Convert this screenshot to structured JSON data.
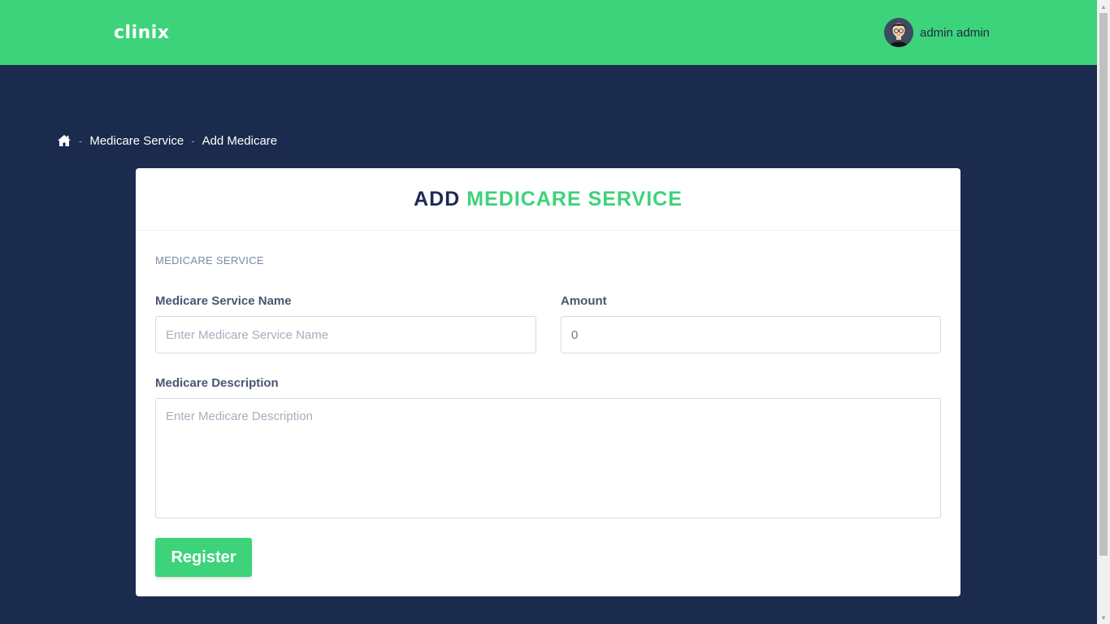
{
  "header": {
    "logo": "clinix",
    "user_name": "admin admin",
    "avatar_icon": "user-avatar-icon"
  },
  "breadcrumb": {
    "home_icon": "home-icon",
    "items": [
      "Medicare Service",
      "Add Medicare"
    ],
    "separator": "-"
  },
  "card": {
    "title_part1": "ADD",
    "title_part2": "MEDICARE SERVICE",
    "section_label": "MEDICARE SERVICE",
    "fields": {
      "service_name": {
        "label": "Medicare Service Name",
        "placeholder": "Enter Medicare Service Name",
        "value": ""
      },
      "amount": {
        "label": "Amount",
        "placeholder": "",
        "value": "0"
      },
      "description": {
        "label": "Medicare Description",
        "placeholder": "Enter Medicare Description",
        "value": ""
      }
    },
    "submit_label": "Register"
  },
  "colors": {
    "accent": "#3dd37a",
    "background": "#1b2b4d",
    "title_dark": "#1e2a54"
  }
}
